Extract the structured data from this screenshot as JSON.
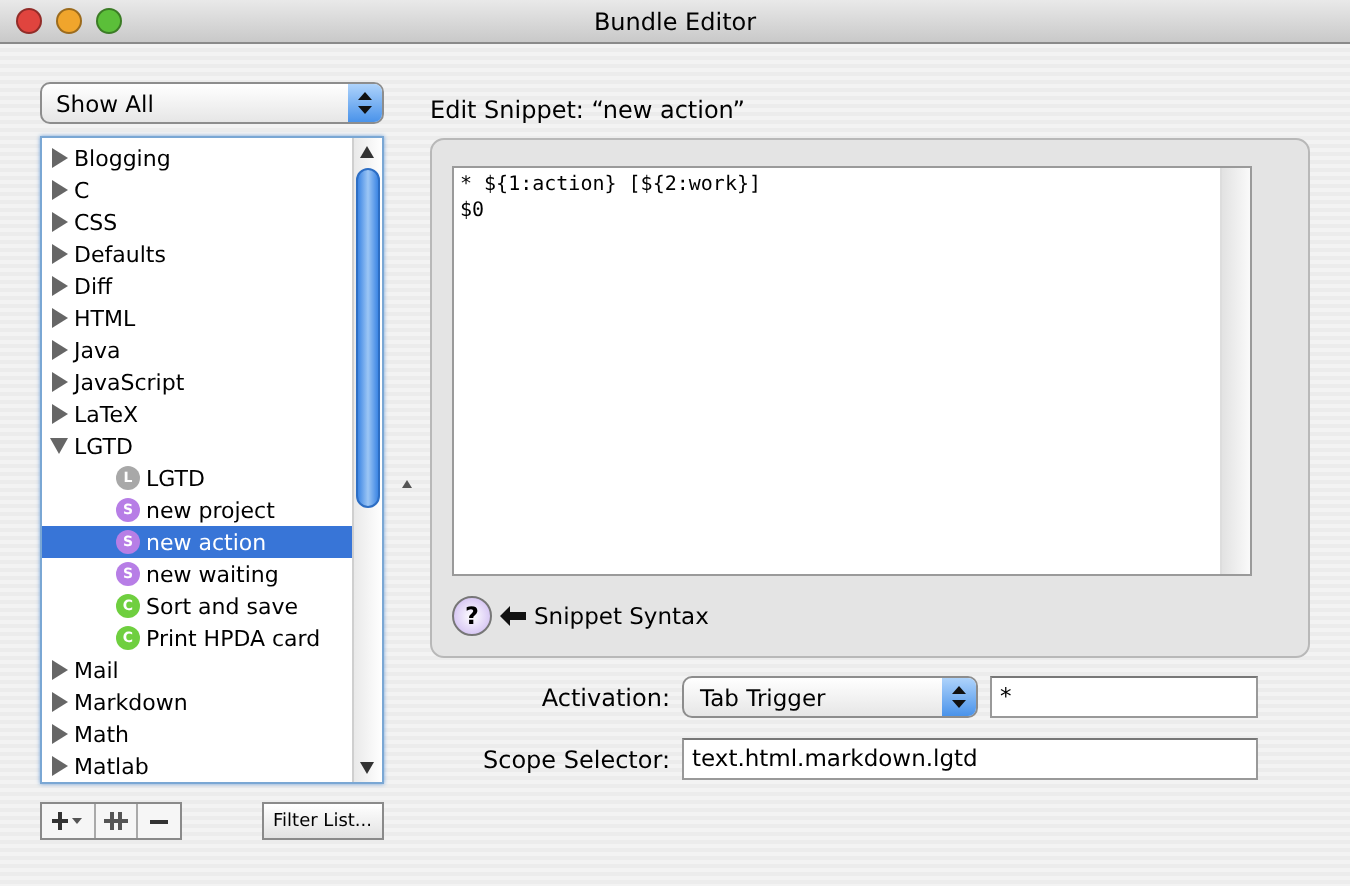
{
  "window": {
    "title": "Bundle Editor"
  },
  "filter_popup": {
    "value": "Show All"
  },
  "tree": [
    {
      "label": "Blogging",
      "expanded": false,
      "selected": false
    },
    {
      "label": "C",
      "expanded": false,
      "selected": false
    },
    {
      "label": "CSS",
      "expanded": false,
      "selected": false
    },
    {
      "label": "Defaults",
      "expanded": false,
      "selected": false
    },
    {
      "label": "Diff",
      "expanded": false,
      "selected": false
    },
    {
      "label": "HTML",
      "expanded": false,
      "selected": false
    },
    {
      "label": "Java",
      "expanded": false,
      "selected": false
    },
    {
      "label": "JavaScript",
      "expanded": false,
      "selected": false
    },
    {
      "label": "LaTeX",
      "expanded": false,
      "selected": false
    },
    {
      "label": "LGTD",
      "expanded": true,
      "selected": false,
      "children": [
        {
          "label": "LGTD",
          "badge": "L",
          "color": "#a8a8a8",
          "selected": false
        },
        {
          "label": "new project",
          "badge": "S",
          "color": "#b77ee6",
          "selected": false
        },
        {
          "label": "new action",
          "badge": "S",
          "color": "#b77ee6",
          "selected": true
        },
        {
          "label": "new waiting",
          "badge": "S",
          "color": "#b77ee6",
          "selected": false
        },
        {
          "label": "Sort and save",
          "badge": "C",
          "color": "#6fcf3f",
          "selected": false
        },
        {
          "label": "Print HPDA card",
          "badge": "C",
          "color": "#6fcf3f",
          "selected": false
        }
      ]
    },
    {
      "label": "Mail",
      "expanded": false,
      "selected": false
    },
    {
      "label": "Markdown",
      "expanded": false,
      "selected": false
    },
    {
      "label": "Math",
      "expanded": false,
      "selected": false
    },
    {
      "label": "Matlab",
      "expanded": false,
      "selected": false
    }
  ],
  "filter_button": "Filter List...",
  "editor": {
    "heading": "Edit Snippet: “new action”",
    "lines": [
      "* ${1:action} [${2:work}]",
      "$0"
    ],
    "help_button": "?",
    "help_label": "Snippet Syntax"
  },
  "activation": {
    "label": "Activation:",
    "value": "Tab Trigger",
    "trigger": "*"
  },
  "scope": {
    "label": "Scope Selector:",
    "value": "text.html.markdown.lgtd"
  }
}
